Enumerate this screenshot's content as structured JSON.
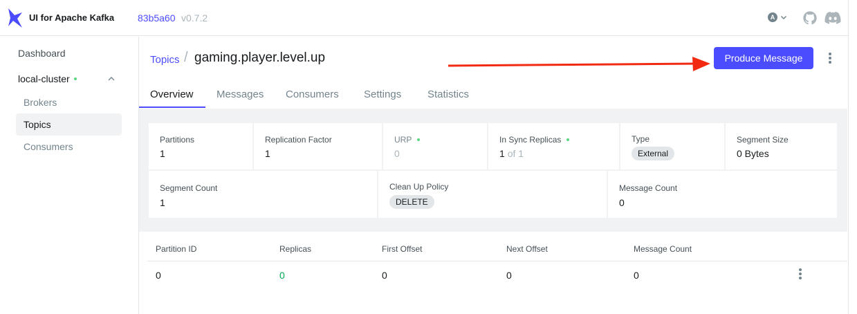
{
  "app": {
    "brand": "UI for Apache Kafka",
    "version_hash": "83b5a60",
    "version_tag": "v0.7.2",
    "user_initial": "A",
    "icons": [
      "logo-icon",
      "chevron-down-icon",
      "github-icon",
      "discord-icon"
    ]
  },
  "sidebar": {
    "dashboard": "Dashboard",
    "cluster": "local-cluster",
    "items": [
      "Brokers",
      "Topics",
      "Consumers"
    ],
    "active_item": "Topics"
  },
  "header": {
    "breadcrumb": "Topics",
    "separator": "/",
    "topic_name": "gaming.player.level.up",
    "produce_button": "Produce Message"
  },
  "tabs": [
    "Overview",
    "Messages",
    "Consumers",
    "Settings",
    "Statistics"
  ],
  "active_tab": "Overview",
  "stats": {
    "partitions": {
      "label": "Partitions",
      "value": "1"
    },
    "replication_factor": {
      "label": "Replication Factor",
      "value": "1"
    },
    "urp": {
      "label": "URP",
      "value": "0"
    },
    "in_sync_replicas": {
      "label": "In Sync Replicas",
      "value": "1",
      "of_text": "of 1"
    },
    "type": {
      "label": "Type",
      "value": "External"
    },
    "segment_size": {
      "label": "Segment Size",
      "value": "0 Bytes"
    },
    "segment_count": {
      "label": "Segment Count",
      "value": "1"
    },
    "cleanup_policy": {
      "label": "Clean Up Policy",
      "value": "DELETE"
    },
    "message_count": {
      "label": "Message Count",
      "value": "0"
    }
  },
  "table": {
    "columns": [
      "Partition ID",
      "Replicas",
      "First Offset",
      "Next Offset",
      "Message Count"
    ],
    "rows": [
      [
        "0",
        "0",
        "0",
        "0",
        "0"
      ]
    ]
  },
  "colors": {
    "accent": "#4c4cff",
    "status_green": "#5cd685",
    "replica_green": "#00ab4e",
    "annotation_arrow": "#f32a12"
  }
}
